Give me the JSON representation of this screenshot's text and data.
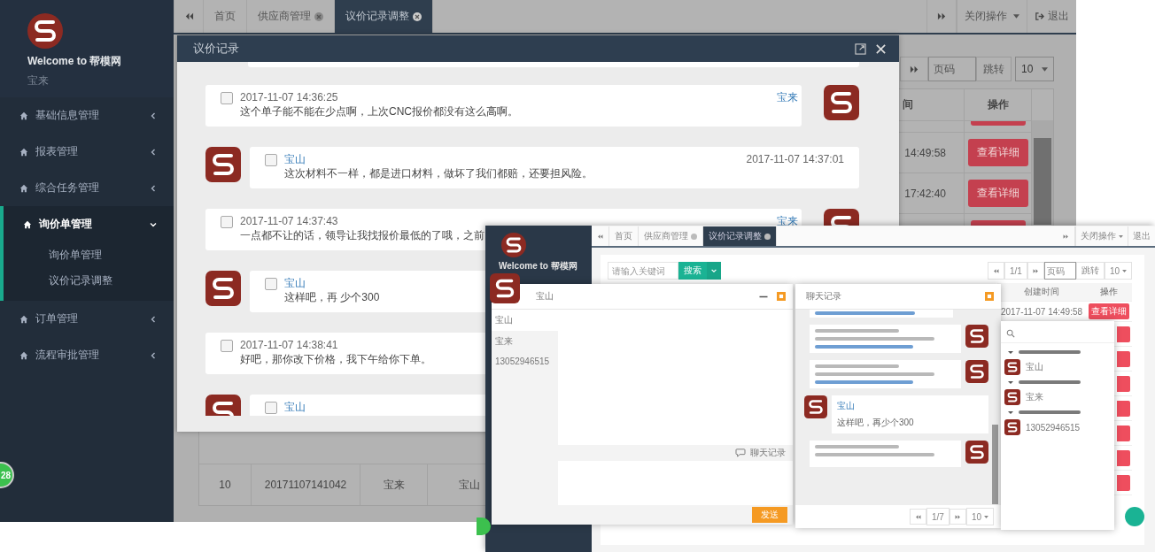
{
  "main_screen": {
    "sidebar": {
      "welcome": "Welcome to 帮模网",
      "user": "宝来",
      "menu": [
        {
          "label": "基础信息管理",
          "expanded": false
        },
        {
          "label": "报表管理",
          "expanded": false
        },
        {
          "label": "综合任务管理",
          "expanded": false
        },
        {
          "label": "询价单管理",
          "expanded": true,
          "children": [
            {
              "label": "询价单管理",
              "selected": false
            },
            {
              "label": "议价记录调整",
              "selected": false
            }
          ]
        },
        {
          "label": "订单管理",
          "expanded": false
        },
        {
          "label": "流程审批管理",
          "expanded": false
        }
      ]
    },
    "notification_badge": "28",
    "tabs": [
      {
        "label": "首页",
        "closable": false,
        "selected": false
      },
      {
        "label": "供应商管理",
        "closable": true,
        "selected": false
      },
      {
        "label": "议价记录调整",
        "closable": true,
        "selected": true
      }
    ],
    "tab_actions": {
      "close_menu": "关闭操作",
      "logout": "退出"
    },
    "pager": {
      "page_placeholder": "页码",
      "jump": "跳转",
      "page_size": "10"
    },
    "table": {
      "columns": [
        "间",
        "操作"
      ],
      "rows": [
        {
          "time": "14:49:58",
          "action": "查看详细"
        },
        {
          "time": "17:42:40",
          "action": "查看详细"
        }
      ],
      "last_row": [
        "10",
        "20171107141042",
        "宝来",
        "宝山"
      ]
    },
    "dialog": {
      "title": "议价记录",
      "messages": [
        {
          "kind": "self",
          "sender": "宝来",
          "time": "2017-11-07 14:36:25",
          "text": "这个单子能不能在少点啊，上次CNC报价都没有这么高啊。",
          "checked": false
        },
        {
          "kind": "other",
          "sender": "宝山",
          "time": "2017-11-07 14:37:01",
          "text": "这次材料不一样，都是进口材料，做坏了我们都赔，还要担风险。",
          "checked": false
        },
        {
          "kind": "self",
          "sender": "宝来",
          "time": "2017-11-07 14:37:43",
          "text": "一点都不让的话，领导让我找报价最低的了哦，之前",
          "checked": false
        },
        {
          "kind": "other",
          "sender": "宝山",
          "text": "这样吧，再 少个300",
          "checked": false
        },
        {
          "kind": "self",
          "time": "2017-11-07 14:38:41",
          "text": "好吧，那你改下价格，我下午给你下单。",
          "checked": false
        },
        {
          "kind": "other",
          "sender": "宝山",
          "checked": false
        }
      ]
    }
  },
  "inset_screen": {
    "welcome": "Welcome to 帮模网",
    "tabs": [
      {
        "label": "首页",
        "closable": false,
        "selected": false
      },
      {
        "label": "供应商管理",
        "closable": true,
        "selected": false
      },
      {
        "label": "议价记录调整",
        "closable": true,
        "selected": true
      }
    ],
    "tab_actions": {
      "close_menu": "关闭操作",
      "logout": "退出"
    },
    "search": {
      "placeholder": "请输入关键词",
      "button": "搜索"
    },
    "pager": {
      "page": "1/1",
      "page_placeholder": "页码",
      "jump": "跳转",
      "page_size": "10"
    },
    "table": {
      "columns": [
        "创建时间",
        "操作"
      ],
      "first_row": {
        "time": "2017-11-07 14:49:58",
        "action": "查看详细"
      }
    },
    "chat": {
      "title": "宝山",
      "contacts": [
        {
          "label": "宝山",
          "selected": true
        },
        {
          "label": "宝来",
          "selected": false
        },
        {
          "label": "13052946515",
          "selected": false
        }
      ],
      "history": "聊天记录",
      "send": "发送"
    },
    "records": {
      "title": "聊天记录",
      "messages": [
        {
          "kind": "self"
        },
        {
          "kind": "self"
        },
        {
          "kind": "other",
          "sender": "宝山",
          "text": "这样吧，再少个300"
        },
        {
          "kind": "self"
        }
      ],
      "pager": {
        "page": "1/7",
        "page_size": "10"
      }
    },
    "contacts_panel": {
      "groups": [
        {
          "expanded": true,
          "members": [
            {
              "label": "宝山"
            }
          ]
        },
        {
          "expanded": true,
          "members": [
            {
              "label": "宝来"
            }
          ]
        },
        {
          "expanded": true,
          "members": [
            {
              "label": "13052946515"
            }
          ]
        }
      ]
    }
  }
}
